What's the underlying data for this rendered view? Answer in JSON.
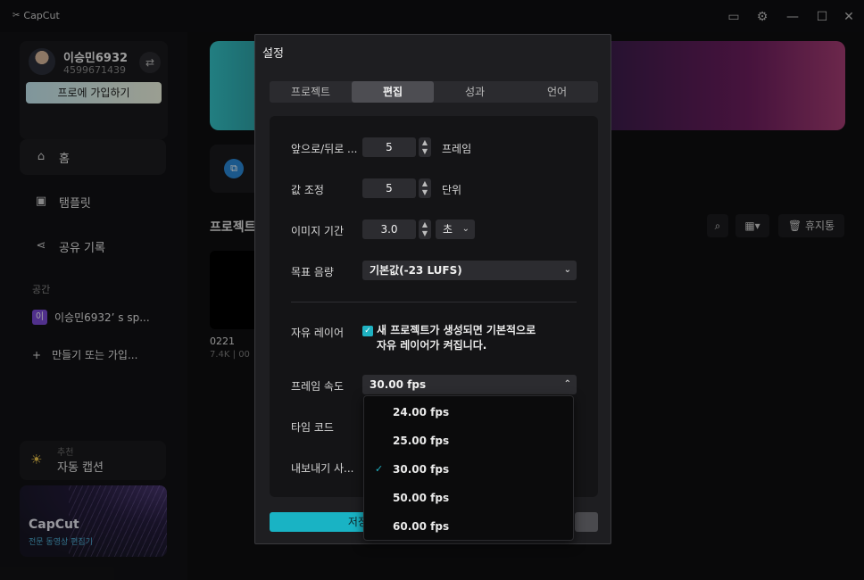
{
  "app": {
    "name": "CapCut"
  },
  "user": {
    "name": "이승민6932",
    "id": "4599671439",
    "join_label": "프로에 가입하기"
  },
  "sidebar": {
    "items": [
      {
        "label": "홈",
        "icon": "home-icon"
      },
      {
        "label": "탬플릿",
        "icon": "template-icon"
      },
      {
        "label": "공유 기록",
        "icon": "share-icon"
      }
    ],
    "space_section": "공간",
    "space_badge": "이",
    "space_name": "이승민6932’ s sp...",
    "create_label": "만들기 또는 가입...",
    "recommend": {
      "label": "추천",
      "title": "자동 캡션"
    },
    "promo": {
      "title": "CapCut",
      "subtitle": "전문 동영상 편집기"
    }
  },
  "main": {
    "projects_title": "프로젝트",
    "project": {
      "name": "0221",
      "meta": "7.4K | 00"
    },
    "trash_label": "휴지통"
  },
  "settings": {
    "title": "설정",
    "tabs": [
      "프로젝트",
      "편집",
      "성과",
      "언어"
    ],
    "active_tab": "편집",
    "rows": {
      "seek_label": "앞으로/뒤로 ...",
      "seek_value": "5",
      "seek_unit": "프레임",
      "adjust_label": "값 조정",
      "adjust_value": "5",
      "adjust_unit": "단위",
      "image_duration_label": "이미지 기간",
      "image_duration_value": "3.0",
      "image_duration_unit": "초",
      "loudness_label": "목표 음량",
      "loudness_value": "기본값(-23 LUFS)",
      "free_layer_label": "자유 레이어",
      "free_layer_text_1": "새 프로젝트가 생성되면 기본적으로",
      "free_layer_text_2": "자유 레이어가 켜집니다.",
      "frame_rate_label": "프레임 속도",
      "frame_rate_value": "30.00 fps",
      "timecode_label": "타임 코드",
      "export_label": "내보내기 사..."
    },
    "save_label": "저장",
    "fps_options": [
      "24.00 fps",
      "25.00 fps",
      "30.00 fps",
      "50.00 fps",
      "60.00 fps"
    ],
    "fps_selected": "30.00 fps"
  },
  "colors": {
    "accent": "#1fb2c2",
    "brand_badge": "#7b4bd6"
  }
}
